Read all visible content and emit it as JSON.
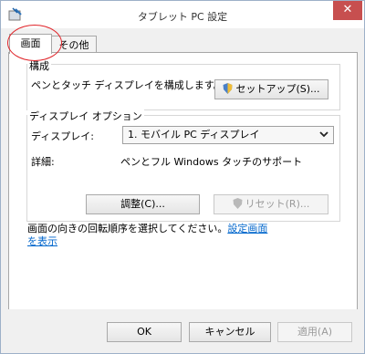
{
  "window": {
    "title": "タブレット PC 設定",
    "close_glyph": "✕"
  },
  "tabs": {
    "screen": "画面",
    "other": "その他"
  },
  "config": {
    "group_label": "構成",
    "description": "ペンとタッチ ディスプレイを構成します。",
    "setup_button": "セットアップ(S)..."
  },
  "display_options": {
    "group_label": "ディスプレイ オプション",
    "display_label": "ディスプレイ:",
    "display_value": "1. モバイル PC ディスプレイ",
    "details_label": "詳細:",
    "details_value": "ペンとフル Windows タッチのサポート",
    "adjust_button": "調整(C)...",
    "reset_button": "リセット(R)..."
  },
  "rotation": {
    "text": "画面の向きの回転順序を選択してください。",
    "link": "設定画面を表示"
  },
  "footer": {
    "ok": "OK",
    "cancel": "キャンセル",
    "apply": "適用(A)"
  },
  "colors": {
    "close_button": "#c74f4f",
    "tab_highlight": "#e0252a",
    "link": "#0066cc"
  }
}
